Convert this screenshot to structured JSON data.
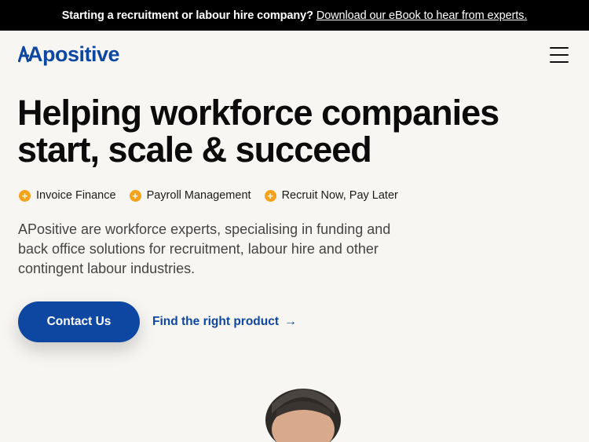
{
  "announcement": {
    "text": "Starting a recruitment or labour hire company?",
    "link": "Download our eBook to hear from experts."
  },
  "header": {
    "logo_text": "Apositive",
    "menu_icon": "hamburger-menu-icon"
  },
  "hero": {
    "title_line1": "Helping workforce companies",
    "title_line2": "start, scale & succeed",
    "features": [
      {
        "label": "Invoice Finance",
        "icon": "plus-circle-icon"
      },
      {
        "label": "Payroll Management",
        "icon": "plus-circle-icon"
      },
      {
        "label": "Recruit Now, Pay Later",
        "icon": "plus-circle-icon"
      }
    ],
    "description": "APositive are workforce experts, specialising in funding and back office solutions for recruitment, labour hire and other contingent labour industries.",
    "contact_label": "Contact Us",
    "find_label": "Find the right product",
    "find_icon": "arrow-right-icon"
  },
  "colors": {
    "brand_blue": "#0d47a1",
    "accent_orange": "#f6a21a",
    "background": "#f8f6f3"
  }
}
